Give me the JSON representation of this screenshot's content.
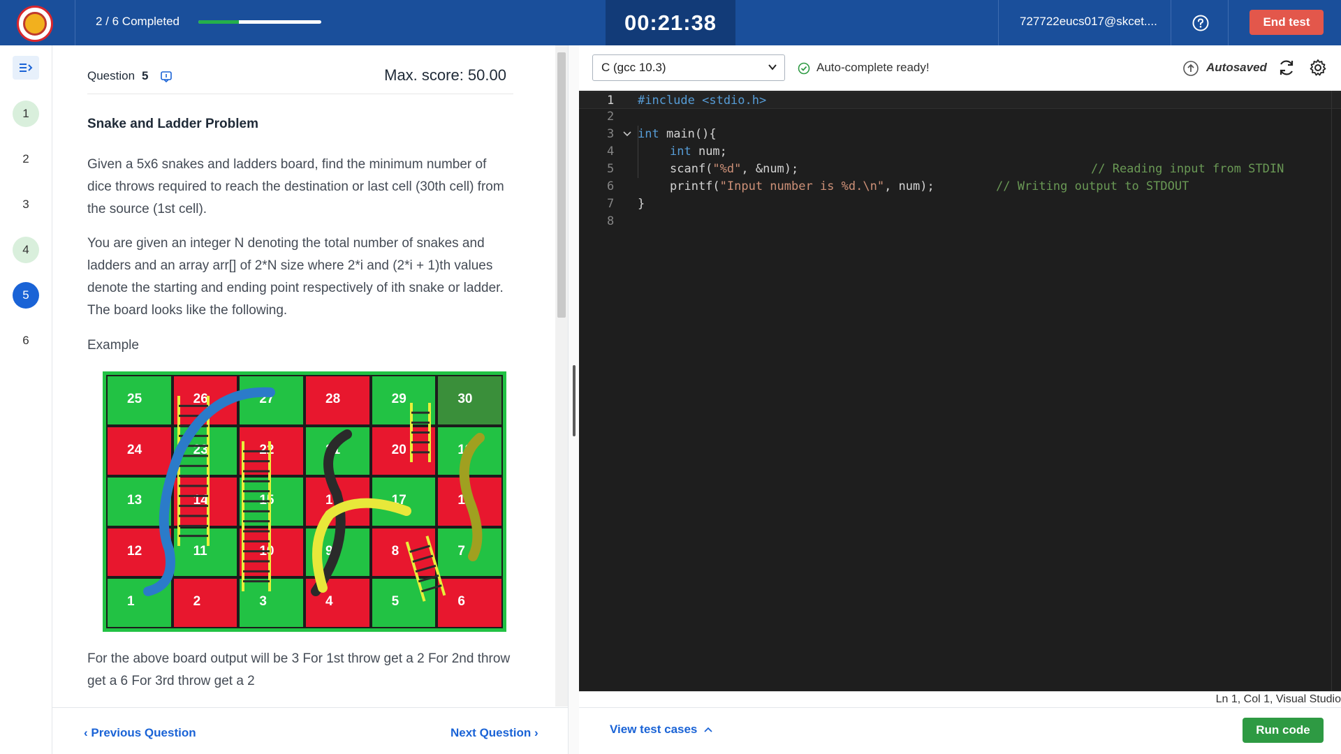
{
  "header": {
    "progress_text": "2 / 6 Completed",
    "progress_fraction": 0.33,
    "timer": "00:21:38",
    "email": "727722eucs017@skcet....",
    "end_test_label": "End test"
  },
  "nav": {
    "questions": [
      {
        "label": "1",
        "status": "answered"
      },
      {
        "label": "2",
        "status": "unanswered"
      },
      {
        "label": "3",
        "status": "unanswered"
      },
      {
        "label": "4",
        "status": "answered"
      },
      {
        "label": "5",
        "status": "current"
      },
      {
        "label": "6",
        "status": "unanswered"
      }
    ]
  },
  "question": {
    "label": "Question",
    "number": "5",
    "max_score": "Max. score: 50.00",
    "title": "Snake and Ladder Problem",
    "para1": "Given a 5x6 snakes and ladders board, find the minimum number of dice throws required to reach the destination or last cell (30th cell) from the source (1st cell).",
    "para2": "You are given an integer N denoting the total number of snakes and ladders and an array arr[] of 2*N size where 2*i and (2*i + 1)th values denote the starting and ending point respectively of ith snake or ladder. The board looks like the following.",
    "example_label": "Example",
    "board_rows": [
      [
        "25",
        "26",
        "27",
        "28",
        "29",
        "30"
      ],
      [
        "24",
        "23",
        "22",
        "21",
        "20",
        "19"
      ],
      [
        "13",
        "14",
        "15",
        "16",
        "17",
        "18"
      ],
      [
        "12",
        "11",
        "10",
        "9",
        "8",
        "7"
      ],
      [
        "1",
        "2",
        "3",
        "4",
        "5",
        "6"
      ]
    ],
    "after_text": "For the above board output will be 3  For 1st throw get a 2 For 2nd throw get a 6 For 3rd throw get a 2"
  },
  "bottom_nav": {
    "prev_label": "Previous Question",
    "next_label": "Next Question"
  },
  "editor": {
    "language": "C (gcc 10.3)",
    "autocomplete_text": "Auto-complete ready!",
    "autosaved_text": "Autosaved",
    "line_numbers": [
      "1",
      "2",
      "3",
      "4",
      "5",
      "6",
      "7",
      "8"
    ],
    "code": {
      "l1": "#include <stdio.h>",
      "l3_kw": "int",
      "l3_rest": " main(){",
      "l4_kw": "int",
      "l4_rest": " num;",
      "l5_pre": "scanf(",
      "l5_str": "\"%d\"",
      "l5_post": ", &num);",
      "l5_comment": "// Reading input from STDIN",
      "l6_pre": "printf(",
      "l6_str": "\"Input number is %d.\\n\"",
      "l6_post": ", num);",
      "l6_comment": "// Writing output to STDOUT",
      "l7": "}"
    },
    "status": "Ln 1, Col 1, Visual Studio",
    "view_test_cases": "View test cases",
    "run_code": "Run code"
  },
  "colors": {
    "header_bg": "#1a4f9b",
    "timer_bg": "#123b78",
    "end_test": "#e3574b",
    "run_code": "#2e9a43",
    "link": "#1a63d6",
    "board_green": "#22c244",
    "board_red": "#e8172e"
  }
}
